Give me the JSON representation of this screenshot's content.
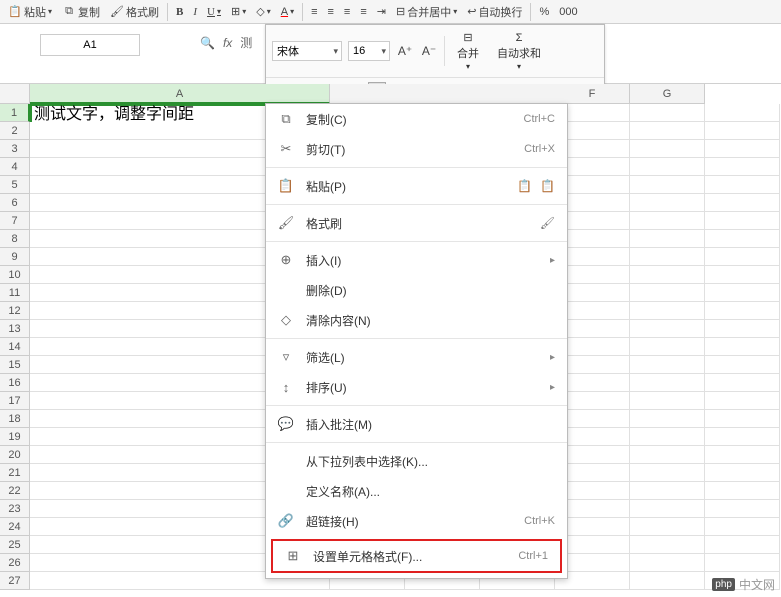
{
  "toolbar": {
    "paste": "粘贴",
    "copy": "复制",
    "format_painter": "格式刷",
    "merge_center": "合并居中",
    "wrap_text": "自动换行"
  },
  "namebox": {
    "value": "A1"
  },
  "fx_label": "测",
  "float_format": {
    "font_name": "宋体",
    "font_size": "16",
    "merge": "合并",
    "autosum": "自动求和"
  },
  "columns": [
    "A",
    "F",
    "G"
  ],
  "cell_a1": "测试文字，调整字间距",
  "rows_count": 27,
  "context_menu": {
    "copy": {
      "label": "复制(C)",
      "shortcut": "Ctrl+C"
    },
    "cut": {
      "label": "剪切(T)",
      "shortcut": "Ctrl+X"
    },
    "paste": {
      "label": "粘贴(P)"
    },
    "format_painter": {
      "label": "格式刷"
    },
    "insert": {
      "label": "插入(I)"
    },
    "delete": {
      "label": "删除(D)"
    },
    "clear": {
      "label": "清除内容(N)"
    },
    "filter": {
      "label": "筛选(L)"
    },
    "sort": {
      "label": "排序(U)"
    },
    "insert_comment": {
      "label": "插入批注(M)"
    },
    "from_dropdown": {
      "label": "从下拉列表中选择(K)..."
    },
    "define_name": {
      "label": "定义名称(A)..."
    },
    "hyperlink": {
      "label": "超链接(H)",
      "shortcut": "Ctrl+K"
    },
    "format_cells": {
      "label": "设置单元格格式(F)...",
      "shortcut": "Ctrl+1"
    }
  },
  "watermark": "中文网"
}
